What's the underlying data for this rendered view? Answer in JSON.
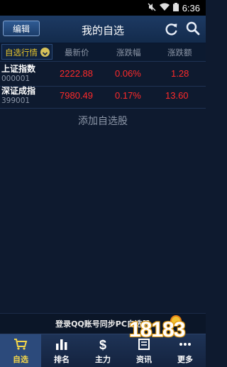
{
  "status_bar": {
    "time": "6:36"
  },
  "header": {
    "edit_label": "编辑",
    "title": "我的自选"
  },
  "columns": {
    "watch_tab": "自选行情",
    "price": "最新价",
    "change_pct": "涨跌幅",
    "change_amt": "涨跌额"
  },
  "rows": [
    {
      "name": "上证指数",
      "code": "000001",
      "price": "2222.88",
      "change_pct": "0.06%",
      "change_amt": "1.28"
    },
    {
      "name": "深证成指",
      "code": "399001",
      "price": "7980.49",
      "change_pct": "0.17%",
      "change_amt": "13.60"
    }
  ],
  "add_stock_label": "添加自选股",
  "login_prompt": "登录QQ账号同步PC自选股",
  "tabbar": [
    {
      "label": "自选",
      "icon": "cart-icon",
      "active": true
    },
    {
      "label": "排名",
      "icon": "bar-chart-icon",
      "active": false
    },
    {
      "label": "主力",
      "icon": "dollar-icon",
      "active": false
    },
    {
      "label": "资讯",
      "icon": "news-icon",
      "active": false
    },
    {
      "label": "更多",
      "icon": "more-icon",
      "active": false
    }
  ],
  "watermark": "18183",
  "colors": {
    "up": "#ff2a2a",
    "accent_yellow": "#e6c42c",
    "header_bg": "#1d3a63"
  }
}
